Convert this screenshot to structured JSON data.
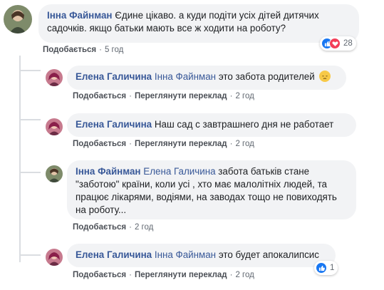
{
  "comments": [
    {
      "author": "Інна Файнман",
      "mention": "",
      "text": "Єдине цікаво. а куди подіти усіх дітей дитячих садочків. якщо батьки мають все ж ходити на роботу?",
      "line1": "Єдине цікаво. а куди подіти усіх дітей дитячих",
      "line2": "садочків. якщо батьки мають все ж ходити на роботу?",
      "like_label": "Подобається",
      "time": "5 год",
      "reactions": {
        "icons": [
          "like-icon",
          "love-icon"
        ],
        "count": "28"
      }
    },
    {
      "author": "Елена Галичина",
      "mention": "Інна Файнман",
      "text": "это забота родителей",
      "emoji": "pensive-face-icon",
      "like_label": "Подобається",
      "translate_label": "Переглянути переклад",
      "time": "2 год"
    },
    {
      "author": "Елена Галичина",
      "mention": "",
      "text": "Наш сад с завтрашнего дня не работает",
      "like_label": "Подобається",
      "translate_label": "Переглянути переклад",
      "time": "2 год"
    },
    {
      "author": "Інна Файнман",
      "mention": "Елена Галичина",
      "line1": "забота батьків стане",
      "line2": "\"заботою\" країни, коли усі , хто має малолітніх людей, та",
      "line3": "працює лікарями, водіями, на заводах тощо не повиходять",
      "line4": "на роботу...",
      "like_label": "Подобається",
      "time": "2 год"
    },
    {
      "author": "Елена Галичина",
      "mention": "Інна Файнман",
      "text": "это будет апокалипсис",
      "like_label": "Подобається",
      "translate_label": "Переглянути переклад",
      "time": "2 год",
      "reactions": {
        "icons": [
          "like-icon"
        ],
        "count": "1"
      }
    }
  ],
  "separator": "·",
  "colors": {
    "link": "#385898",
    "bubble": "#f2f3f5",
    "like": "#1877f2",
    "love": "#f33e58",
    "meta": "#606770"
  }
}
